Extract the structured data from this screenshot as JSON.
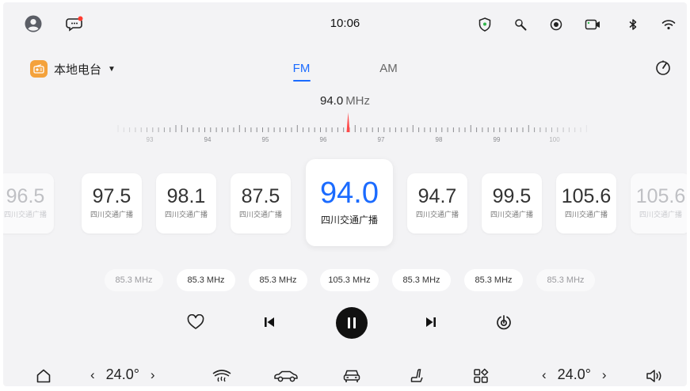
{
  "status_bar": {
    "time": "10:06",
    "left_icons": [
      "avatar-icon",
      "message-icon"
    ],
    "right_icons": [
      "shield-icon",
      "wrench-icon",
      "record-icon",
      "camera-icon",
      "bluetooth-icon",
      "wifi-icon"
    ]
  },
  "source": {
    "label": "本地电台",
    "icon": "radio-icon"
  },
  "tabs": [
    {
      "label": "FM",
      "active": true
    },
    {
      "label": "AM",
      "active": false
    }
  ],
  "tuner": {
    "frequency": "94.0",
    "unit": "MHz",
    "scale_labels": [
      "93",
      "94",
      "95",
      "96",
      "97",
      "98",
      "99",
      "100"
    ]
  },
  "stations": [
    {
      "freq": "96.5",
      "name": "四川交通广播",
      "faded": true
    },
    {
      "freq": "97.5",
      "name": "四川交通广播"
    },
    {
      "freq": "98.1",
      "name": "四川交通广播"
    },
    {
      "freq": "87.5",
      "name": "四川交通广播"
    },
    {
      "freq": "94.0",
      "name": "四川交通广播",
      "selected": true
    },
    {
      "freq": "94.7",
      "name": "四川交通广播"
    },
    {
      "freq": "99.5",
      "name": "四川交通广播"
    },
    {
      "freq": "105.6",
      "name": "四川交通广播"
    },
    {
      "freq": "105.6",
      "name": "四川交通广播",
      "faded": true
    }
  ],
  "presets": [
    "85.3 MHz",
    "85.3 MHz",
    "85.3 MHz",
    "105.3 MHz",
    "85.3 MHz",
    "85.3 MHz",
    "85.3 MHz"
  ],
  "controls": [
    "favorite-icon",
    "previous-icon",
    "pause-icon",
    "next-icon",
    "scan-icon"
  ],
  "bottom_bar": {
    "left_temp": "24.0°",
    "right_temp": "24.0°",
    "icons": [
      "home-icon",
      "defrost-icon",
      "car-icon",
      "car-front-icon",
      "seat-icon",
      "apps-icon",
      "volume-icon"
    ]
  },
  "colors": {
    "accent": "#1b6bff",
    "needle": "#ff4a4a",
    "badge": "#f4a23c",
    "notification": "#ff3b30"
  }
}
